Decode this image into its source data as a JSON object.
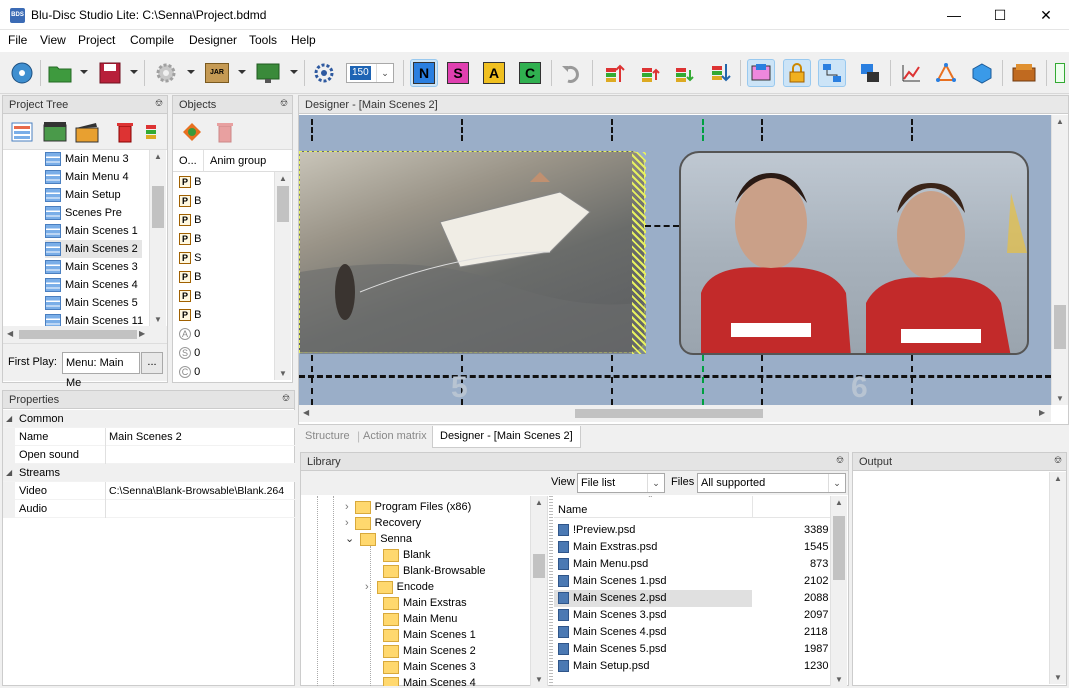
{
  "window": {
    "title": "Blu-Disc Studio Lite: C:\\Senna\\Project.bdmd",
    "app_icon_text": "BDS"
  },
  "menu": [
    "File",
    "View",
    "Project",
    "Compile",
    "Designer",
    "Tools",
    "Help"
  ],
  "toolbar": {
    "zoom_value": "150",
    "letter_buttons": [
      "N",
      "S",
      "A",
      "C"
    ],
    "jar_label": "JAR"
  },
  "project_tree": {
    "title": "Project Tree",
    "items": [
      "Main Menu 3",
      "Main Menu 4",
      "Main Setup",
      "Scenes Pre",
      "Main Scenes 1",
      "Main Scenes 2",
      "Main Scenes 3",
      "Main Scenes 4",
      "Main Scenes 5",
      "Main Scenes 11"
    ],
    "selected": "Main Scenes 2",
    "first_play_label": "First Play:",
    "first_play_value": "Menu: Main Me",
    "browse_label": "..."
  },
  "objects": {
    "title": "Objects",
    "col1": "O...",
    "col2": "Anim group",
    "rows": [
      "B",
      "B",
      "B",
      "B",
      "S",
      "B",
      "B",
      "B",
      "0",
      "0",
      "0"
    ],
    "row_icons": [
      "P",
      "P",
      "P",
      "P",
      "P",
      "P",
      "P",
      "P",
      "A",
      "S",
      "C"
    ]
  },
  "designer": {
    "title": "Designer - [Main Scenes 2]",
    "labels": [
      "5",
      "6"
    ],
    "image_left": "Boat and water-skier",
    "image_right": "Two racing drivers"
  },
  "tabs": [
    "Structure",
    "Action matrix",
    "Designer - [Main Scenes 2]"
  ],
  "active_tab": "Designer - [Main Scenes 2]",
  "properties": {
    "title": "Properties",
    "groups": [
      {
        "name": "Common",
        "rows": [
          {
            "k": "Name",
            "v": "Main Scenes 2"
          },
          {
            "k": "Open sound",
            "v": ""
          }
        ]
      },
      {
        "name": "Streams",
        "rows": [
          {
            "k": "Video",
            "v": "C:\\Senna\\Blank-Browsable\\Blank.264"
          },
          {
            "k": "Audio",
            "v": ""
          }
        ]
      }
    ]
  },
  "library": {
    "title": "Library",
    "view_label": "View",
    "view_value": "File list",
    "files_label": "Files",
    "files_value": "All supported",
    "folders": [
      {
        "name": "Program Files (x86)",
        "level": 0,
        "expander": "›"
      },
      {
        "name": "Recovery",
        "level": 0,
        "expander": "›"
      },
      {
        "name": "Senna",
        "level": 0,
        "expander": "⌄"
      },
      {
        "name": "Blank",
        "level": 1,
        "expander": ""
      },
      {
        "name": "Blank-Browsable",
        "level": 1,
        "expander": ""
      },
      {
        "name": "Encode",
        "level": 1,
        "expander": "›"
      },
      {
        "name": "Main Exstras",
        "level": 1,
        "expander": ""
      },
      {
        "name": "Main Menu",
        "level": 1,
        "expander": ""
      },
      {
        "name": "Main Scenes 1",
        "level": 1,
        "expander": ""
      },
      {
        "name": "Main Scenes 2",
        "level": 1,
        "expander": ""
      },
      {
        "name": "Main Scenes 3",
        "level": 1,
        "expander": ""
      },
      {
        "name": "Main Scenes 4",
        "level": 1,
        "expander": ""
      }
    ],
    "file_header": "Name",
    "files": [
      {
        "name": "!Preview.psd",
        "size": "3389"
      },
      {
        "name": "Main Exstras.psd",
        "size": "1545"
      },
      {
        "name": "Main Menu.psd",
        "size": "873"
      },
      {
        "name": "Main Scenes 1.psd",
        "size": "2102"
      },
      {
        "name": "Main Scenes 2.psd",
        "size": "2088"
      },
      {
        "name": "Main Scenes 3.psd",
        "size": "2097"
      },
      {
        "name": "Main Scenes 4.psd",
        "size": "2118"
      },
      {
        "name": "Main Scenes 5.psd",
        "size": "1987"
      },
      {
        "name": "Main Setup.psd",
        "size": "1230"
      }
    ],
    "selected_file": "Main Scenes 2.psd"
  },
  "output": {
    "title": "Output"
  },
  "colors": {
    "selection": "#cce4f7",
    "panel_header": "#e4e4e4",
    "designer_bg": "#9aaec8",
    "highlight_green": "#00a040"
  }
}
